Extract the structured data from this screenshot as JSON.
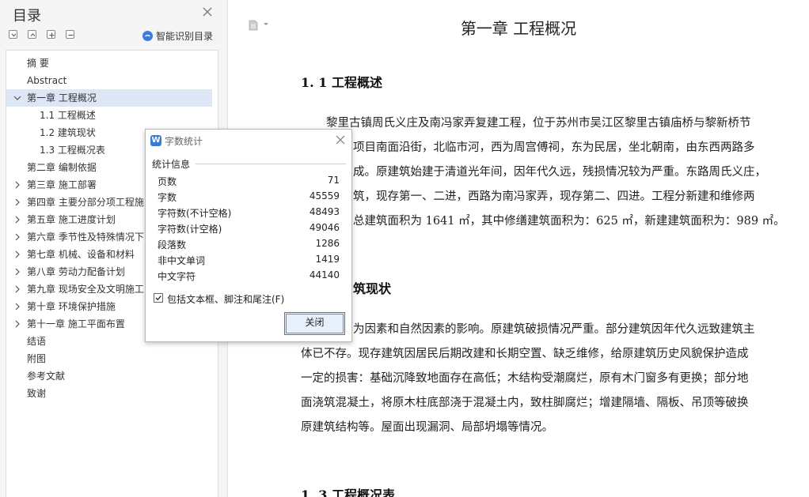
{
  "sidebar": {
    "title": "目录",
    "smart_toc_label": "智能识别目录",
    "toc": [
      {
        "label": "摘  要",
        "level": 1,
        "expandable": false
      },
      {
        "label": "Abstract",
        "level": 1,
        "expandable": false
      },
      {
        "label": "第一章  工程概况",
        "level": 1,
        "expandable": true,
        "expanded": true,
        "selected": true
      },
      {
        "label": "1.1 工程概述",
        "level": 2,
        "expandable": false
      },
      {
        "label": "1.2 建筑现状",
        "level": 2,
        "expandable": false
      },
      {
        "label": "1.3 工程概况表",
        "level": 2,
        "expandable": false
      },
      {
        "label": "第二章  编制依据",
        "level": 1,
        "expandable": false
      },
      {
        "label": "第三章  施工部署",
        "level": 1,
        "expandable": true
      },
      {
        "label": "第四章  主要分部分项工程施",
        "level": 1,
        "expandable": true
      },
      {
        "label": "第五章  施工进度计划",
        "level": 1,
        "expandable": true
      },
      {
        "label": "第六章  季节性及特殊情况下",
        "level": 1,
        "expandable": true
      },
      {
        "label": "第七章  机械、设备和材料",
        "level": 1,
        "expandable": true
      },
      {
        "label": "第八章  劳动力配备计划",
        "level": 1,
        "expandable": true
      },
      {
        "label": "第九章  现场安全及文明施工",
        "level": 1,
        "expandable": true
      },
      {
        "label": "第十章  环境保护措施",
        "level": 1,
        "expandable": true
      },
      {
        "label": "第十一章  施工平面布置",
        "level": 1,
        "expandable": true
      },
      {
        "label": "结语",
        "level": 1,
        "expandable": false
      },
      {
        "label": "附图",
        "level": 1,
        "expandable": false
      },
      {
        "label": "参考文献",
        "level": 1,
        "expandable": false
      },
      {
        "label": "致谢",
        "level": 1,
        "expandable": false
      }
    ]
  },
  "document": {
    "chapter_title": "第一章  工程概况",
    "sections": [
      {
        "heading": "1. 1 工程概述",
        "lines": [
          "黎里古镇周氏义庄及南冯家弄复建工程，位于苏州市吴江区黎里古镇庙桥与黎新桥节",
          "项目南面沿街，北临市河，西为周宫傅祠，东为民居，坐北朝南，由东西两路多",
          "成。原建筑始建于清道光年间，因年代久远，残损情况较为严重。东路周氏义庄，",
          "筑，现存第一、二进，西路为南冯家弄，现存第二、四进。工程分新建和维修两",
          "总建筑面积为 1641 ㎡，其中修缮建筑面积为：625 ㎡，新建建筑面积为：989 ㎡。"
        ]
      },
      {
        "heading": "筑现状",
        "lines": [
          "为因素和自然因素的影响。原建筑破损情况严重。部分建筑因年代久远致建筑主",
          "体已不存。现存建筑因居民后期改建和长期空置、缺乏维修，给原建筑历史风貌保护造成",
          "一定的损害：基础沉降致地面存在高低；木结构受潮腐烂，原有木门窗多有更换；部分地",
          "面浇筑混凝土，将原木柱底部浇于混凝土内，致柱脚腐烂；增建隔墙、隔板、吊顶等破换",
          "原建筑结构等。屋面出现漏洞、局部坍塌等情况。"
        ]
      },
      {
        "heading": "1. 3 工程概况表",
        "lines": []
      }
    ]
  },
  "dialog": {
    "title": "字数统计",
    "group_label": "统计信息",
    "stats": [
      {
        "label": "页数",
        "value": "71"
      },
      {
        "label": "字数",
        "value": "45559"
      },
      {
        "label": "字符数(不计空格)",
        "value": "48493"
      },
      {
        "label": "字符数(计空格)",
        "value": "49046"
      },
      {
        "label": "段落数",
        "value": "1286"
      },
      {
        "label": "非中文单词",
        "value": "1419"
      },
      {
        "label": "中文字符",
        "value": "44140"
      }
    ],
    "checkbox_label": "包括文本框、脚注和尾注(F)",
    "checkbox_checked": true,
    "close_button": "关闭"
  }
}
